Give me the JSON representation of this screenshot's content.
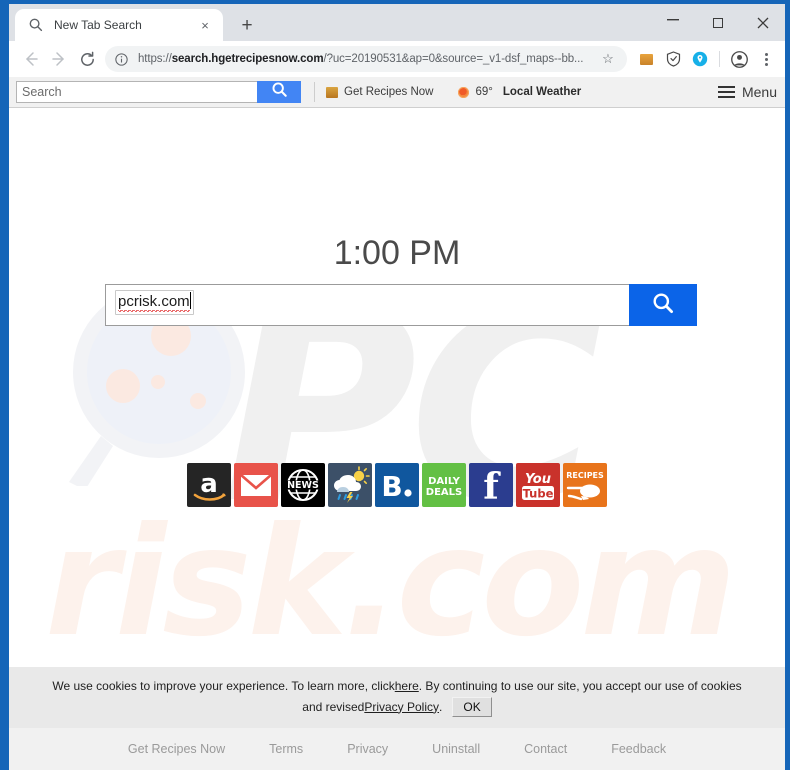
{
  "window": {
    "controls": {
      "minimize": "–",
      "maximize": "□",
      "close": "×"
    }
  },
  "tabbar": {
    "tab": {
      "title": "New Tab Search",
      "favicon": "search-icon",
      "close": "×"
    },
    "new_tab": "+"
  },
  "navbar": {
    "back": "←",
    "forward": "→",
    "reload": "⟳",
    "info_icon": "info-circle-icon",
    "url_prefix": "https://",
    "url_domain": "search.hgetrecipesnow.com",
    "url_path": "/?uc=20190531&ap=0&source=_v1-dsf_maps--bb...",
    "star": "☆",
    "icons": [
      "extension-icon",
      "shield-icon",
      "location-pin-icon",
      "profile-avatar-icon",
      "three-dot-menu-icon"
    ]
  },
  "ext_toolbar": {
    "search_placeholder": "Search",
    "search_value": "",
    "search_button_icon": "search-icon",
    "recipes_link": "Get Recipes Now",
    "weather_temp": "69°",
    "weather_label": "Local Weather",
    "menu_label": "Menu"
  },
  "page": {
    "clock": "1:00 PM",
    "search_value": "pcrisk.com",
    "search_button_icon": "search-icon",
    "watermark_pc": "PC",
    "watermark_risk": "risk.com",
    "tiles": [
      {
        "name": "amazon",
        "label": "a",
        "icon": "amazon-icon"
      },
      {
        "name": "gmail",
        "label": "",
        "icon": "gmail-icon"
      },
      {
        "name": "news",
        "label": "NEWS",
        "icon": "news-globe-icon"
      },
      {
        "name": "weather",
        "label": "",
        "icon": "weather-cloud-sun-icon"
      },
      {
        "name": "booking",
        "label": "B.",
        "icon": "booking-icon"
      },
      {
        "name": "daily-deals",
        "label": "DAILY DEALS",
        "icon": "daily-deals-icon"
      },
      {
        "name": "facebook",
        "label": "f",
        "icon": "facebook-icon"
      },
      {
        "name": "youtube",
        "label": "You Tube",
        "icon": "youtube-icon"
      },
      {
        "name": "recipes",
        "label": "RECIPES",
        "icon": "recipes-icon"
      }
    ]
  },
  "cookie_banner": {
    "text_before_here": "We use cookies to improve your experience. To learn more, click ",
    "here_link": "here",
    "text_after_here": ". By continuing to use our site, you accept our use of cookies",
    "text_line2_before": "and revised ",
    "privacy_link": "Privacy Policy",
    "text_line2_after": ".",
    "ok_button": "OK"
  },
  "footer": {
    "links": [
      "Get Recipes Now",
      "Terms",
      "Privacy",
      "Uninstall",
      "Contact",
      "Feedback"
    ]
  },
  "colors": {
    "window_frame": "#1565b8",
    "accent_blue": "#0b64e8",
    "ext_search_blue": "#4285f4",
    "banner_bg": "#e9e9e9",
    "footer_bg": "#f1f1f1",
    "watermark_gray": "#f0f0f0",
    "watermark_peach": "#fdf2ec"
  }
}
